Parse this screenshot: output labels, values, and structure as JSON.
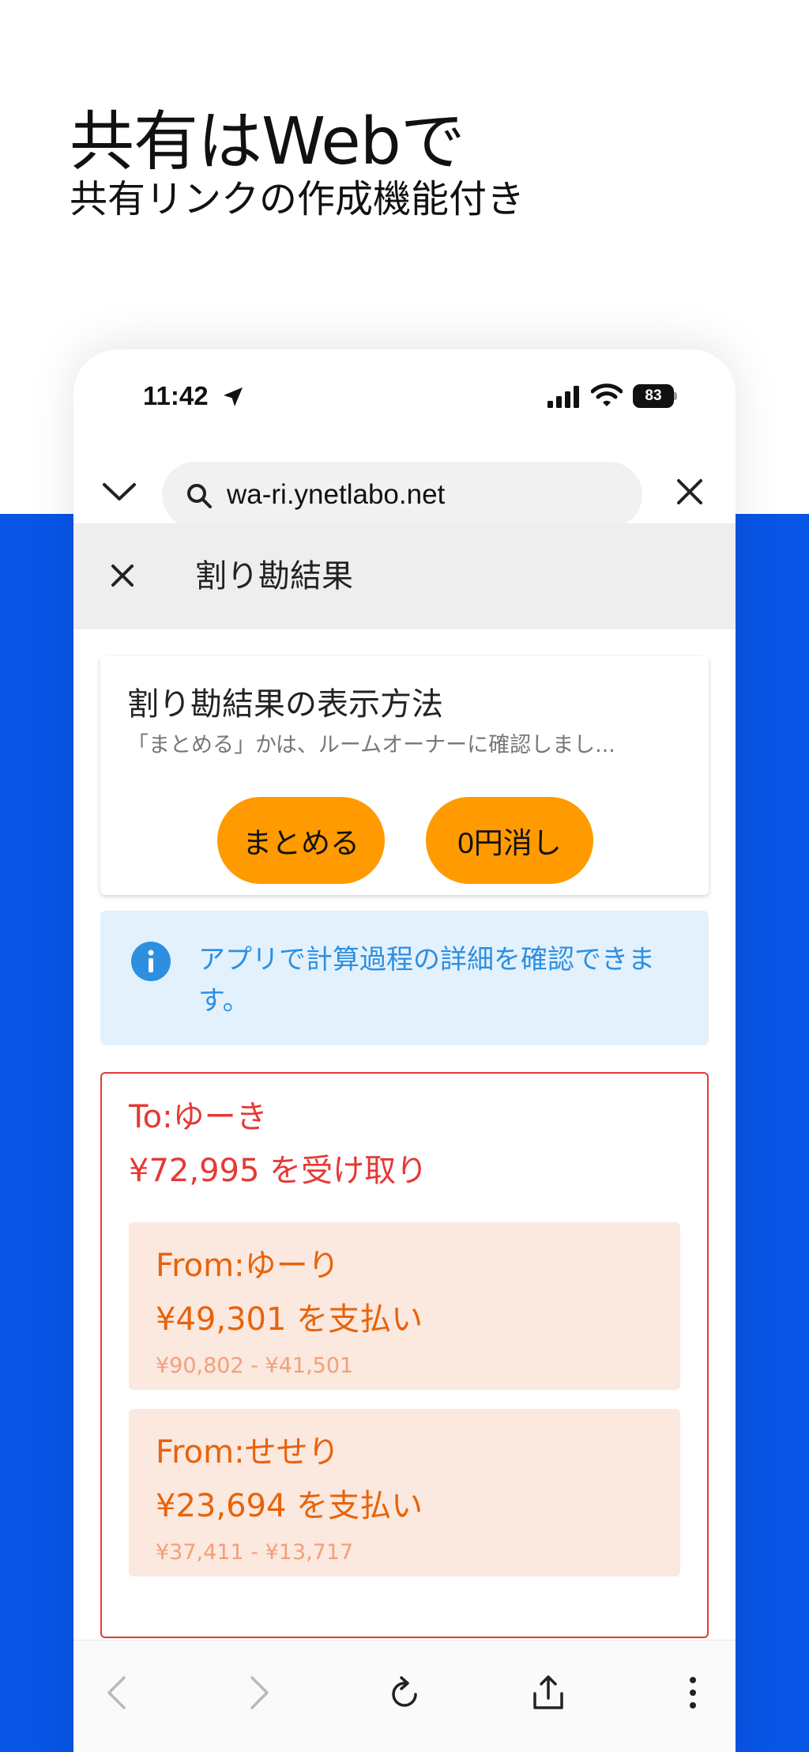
{
  "promo": {
    "headline": "共有はWebで",
    "subline": "共有リンクの作成機能付き"
  },
  "status_bar": {
    "time": "11:42",
    "battery": "83"
  },
  "browser": {
    "url": "wa-ri.ynetlabo.net"
  },
  "appbar": {
    "title": "割り勘結果"
  },
  "display_method": {
    "title": "割り勘結果の表示方法",
    "note": "「まとめる」かは、ルームオーナーに確認しまし...",
    "buttons": {
      "matomeru": "まとめる",
      "zero_yen": "0円消し"
    }
  },
  "info": {
    "text": "アプリで計算過程の詳細を確認できます。"
  },
  "result": {
    "to_name": "To:ゆーき",
    "to_amount": "¥72,995 を受け取り",
    "from": [
      {
        "name": "From:ゆーり",
        "amount": "¥49,301 を支払い",
        "calc": "¥90,802 - ¥41,501"
      },
      {
        "name": "From:せせり",
        "amount": "¥23,694 を支払い",
        "calc": "¥37,411 - ¥13,717"
      }
    ]
  },
  "colors": {
    "blue_background": "#0855e6",
    "button_orange": "#ff9a00",
    "receive_red": "#e53935",
    "pay_orange": "#e8630a",
    "info_blue": "#2d8fe0"
  }
}
